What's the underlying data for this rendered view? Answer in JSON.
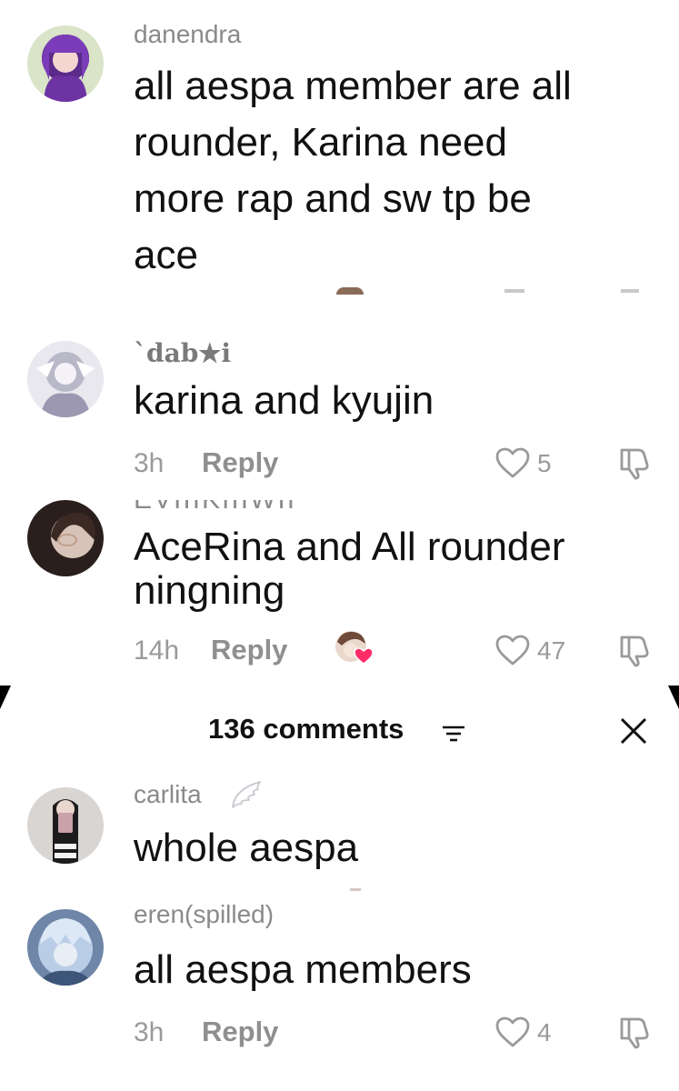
{
  "comments_top": [
    {
      "username": "danendra",
      "text_lines": [
        "all aespa member are all",
        "rounder, Karina need",
        "more rap and sw tp be",
        "ace"
      ]
    },
    {
      "username": "`dab★i",
      "text_lines": [
        "karina and kyujin"
      ],
      "time": "3h",
      "reply": "Reply",
      "likes": "5"
    },
    {
      "username": "EVIIIKIIIWII",
      "text_lines": [
        "AceRina and All rounder",
        "ningning"
      ],
      "time": "14h",
      "reply": "Reply",
      "likes": "47"
    }
  ],
  "panel": {
    "title": "136 comments",
    "sort_icon": "sort-lines-icon",
    "close_icon": "close-icon"
  },
  "comments_bottom": [
    {
      "username": "carlita",
      "badge_icon": "angel-wing-icon",
      "text_lines": [
        "whole aespa"
      ]
    },
    {
      "username": "eren(spilled)",
      "text_lines": [
        "all aespa members"
      ],
      "time": "3h",
      "reply": "Reply",
      "likes": "4"
    }
  ],
  "icons": {
    "like": "heart-outline-icon",
    "dislike": "thumb-down-icon",
    "liked_by_creator": "creator-avatar-heart-icon"
  },
  "colors": {
    "text": "#111111",
    "muted": "#8a8a8a",
    "heart_pink": "#ff2d67"
  }
}
